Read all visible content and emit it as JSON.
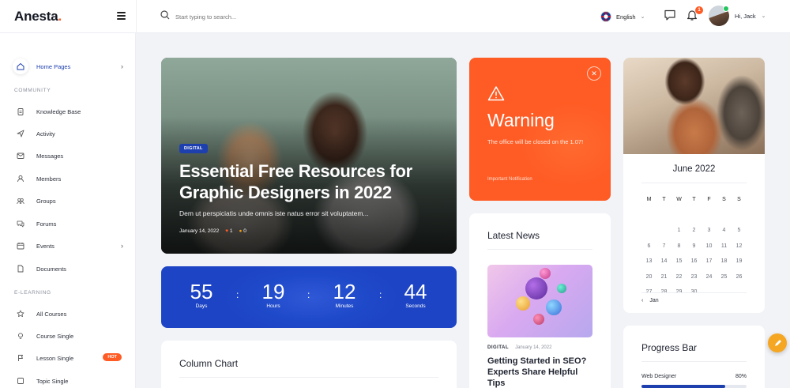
{
  "brand": {
    "name": "Anesta",
    "dot": "."
  },
  "search": {
    "placeholder": "Start typing to search..."
  },
  "header": {
    "language": "English",
    "notification_count": "1",
    "greeting": "Hi, Jack"
  },
  "sidebar": {
    "home": "Home Pages",
    "community_title": "COMMUNITY",
    "community": [
      "Knowledge Base",
      "Activity",
      "Messages",
      "Members",
      "Groups",
      "Forums",
      "Events",
      "Documents"
    ],
    "elearning_title": "E-LEARNING",
    "elearning": [
      "All Courses",
      "Course Single",
      "Lesson Single",
      "Topic Single"
    ],
    "hot_badge": "HOT"
  },
  "hero": {
    "tag": "DIGITAL",
    "title": "Essential Free Resources for Graphic Designers in 2022",
    "excerpt": "Dem ut perspiciatis unde omnis iste natus error sit voluptatem...",
    "date": "January 14, 2022",
    "likes": "1",
    "comments": "0"
  },
  "countdown": {
    "days": "55",
    "days_label": "Days",
    "hours": "19",
    "hours_label": "Hours",
    "minutes": "12",
    "minutes_label": "Minutes",
    "seconds": "44",
    "seconds_label": "Seconds",
    "sep": ":"
  },
  "column_chart": {
    "title": "Column Chart"
  },
  "warning": {
    "title": "Warning",
    "message": "The office will be closed on the 1.07!",
    "note": "Important Notification"
  },
  "news": {
    "title": "Latest News",
    "category": "DIGITAL",
    "date": "January 14, 2022",
    "headline": "Getting Started in SEO? Experts Share Helpful Tips"
  },
  "calendar": {
    "month": "June 2022",
    "weekdays": [
      "M",
      "T",
      "W",
      "T",
      "F",
      "S",
      "S"
    ],
    "weeks": [
      [
        "",
        "",
        "",
        "",
        "",
        "",
        ""
      ],
      [
        "",
        "",
        "1",
        "2",
        "3",
        "4",
        "5"
      ],
      [
        "6",
        "7",
        "8",
        "9",
        "10",
        "11",
        "12"
      ],
      [
        "13",
        "14",
        "15",
        "16",
        "17",
        "18",
        "19"
      ],
      [
        "20",
        "21",
        "22",
        "23",
        "24",
        "25",
        "26"
      ],
      [
        "27",
        "28",
        "29",
        "30",
        "",
        "",
        ""
      ]
    ],
    "prev_label": "Jan"
  },
  "progress": {
    "title": "Progress Bar",
    "label": "Web Designer",
    "value_text": "80%",
    "value": 0.8
  },
  "colors": {
    "accent": "#1e40af",
    "orange": "#ff5b24",
    "fab": "#f5a623"
  }
}
